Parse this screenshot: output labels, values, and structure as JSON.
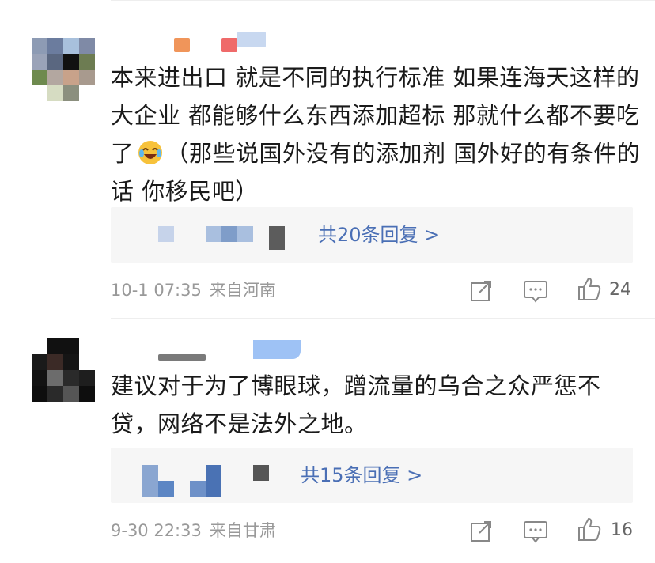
{
  "comments": [
    {
      "text": "本来进出口 就是不同的执行标准 如果连海天这样的大企业 都能够什么东西添加超标 那就什么都不要吃了",
      "text_after_emoji": "（那些说国外没有的添加剂 国外好的有条件的话 你移民吧）",
      "emoji": "laughing-crying-emoji",
      "replies_label": "共20条回复 >",
      "time": "10-1 07:35",
      "location": "来自河南",
      "likes": "24"
    },
    {
      "text": "建议对于为了博眼球，蹭流量的乌合之众严惩不贷，网络不是法外之地。",
      "replies_label": "共15条回复 >",
      "time": "9-30 22:33",
      "location": "来自甘肃",
      "likes": "16"
    }
  ],
  "icons": {
    "share": "share-icon",
    "comment": "comment-icon",
    "like": "thumbs-up-icon"
  },
  "colors": {
    "link": "#4a6fb5",
    "meta": "#999999",
    "reply_bg": "#f6f6f6"
  }
}
